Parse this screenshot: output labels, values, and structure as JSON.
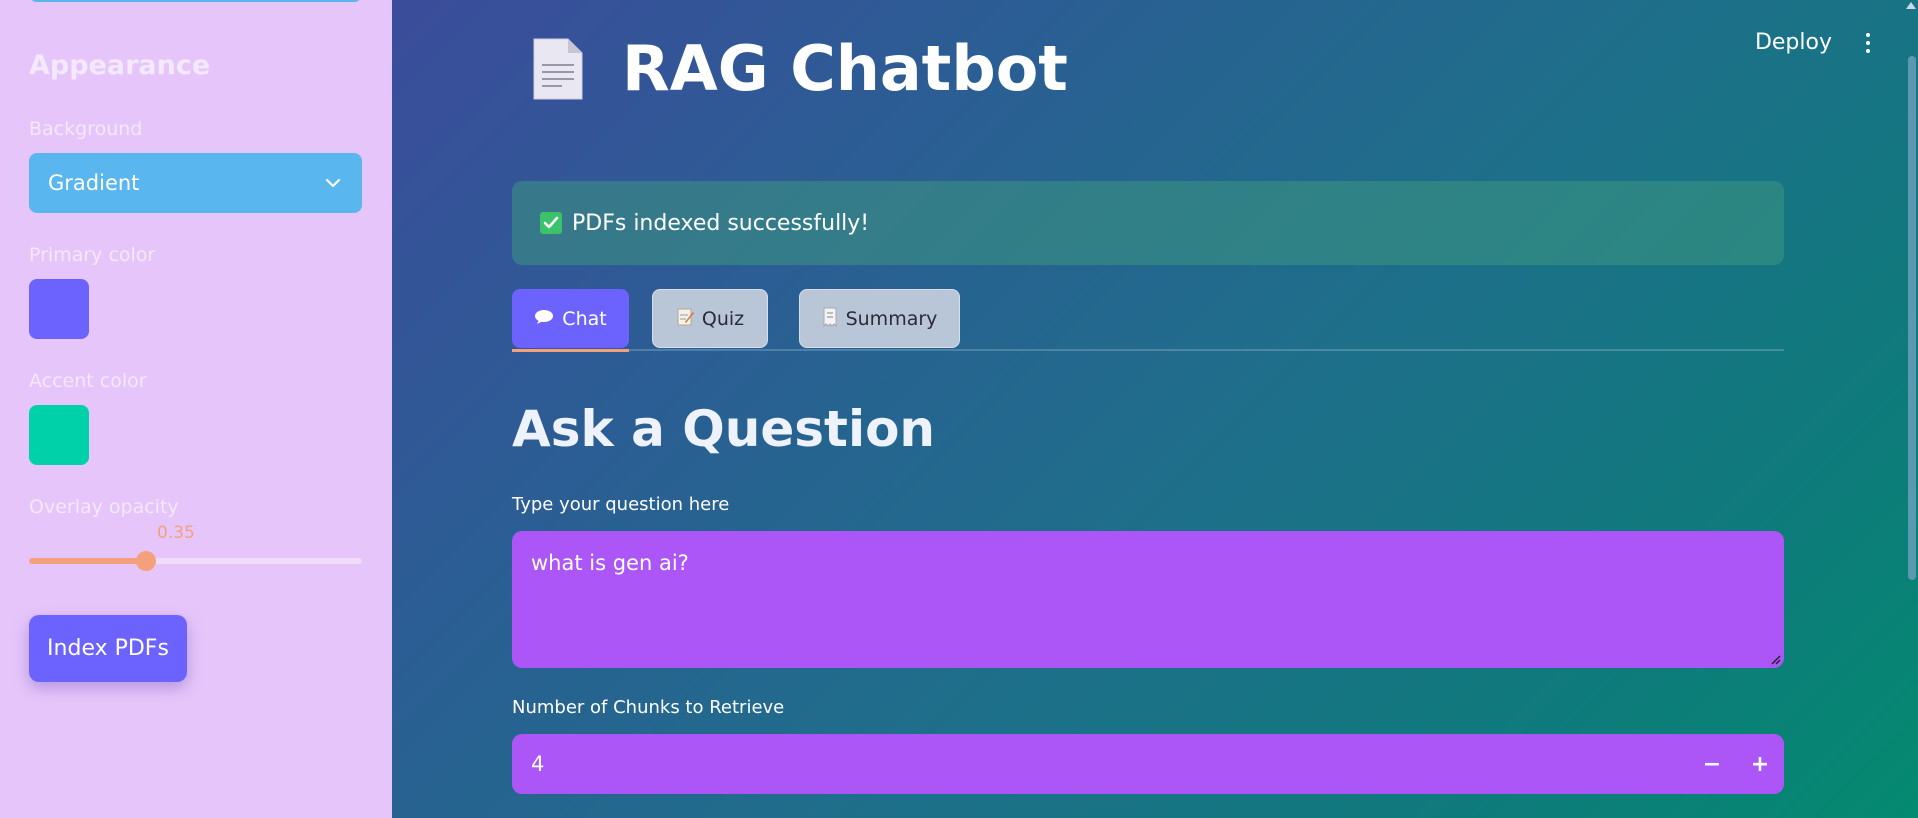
{
  "sidebar": {
    "appearance_heading": "Appearance",
    "background_label": "Background",
    "background_value": "Gradient",
    "primary_color_label": "Primary color",
    "primary_color": "#6c63ff",
    "accent_color_label": "Accent color",
    "accent_color": "#00d1a8",
    "overlay_opacity_label": "Overlay opacity",
    "overlay_opacity_value": "0.35",
    "overlay_opacity_fraction": 0.35,
    "index_button": "Index PDFs"
  },
  "header": {
    "deploy_label": "Deploy",
    "menu_icon": "kebab-menu-icon"
  },
  "main": {
    "title_icon": "document-icon",
    "title": "RAG Chatbot",
    "alert_icon": "checkmark-icon",
    "alert_text": "PDFs indexed successfully!",
    "tabs": [
      {
        "icon": "speech-bubble-icon",
        "label": "Chat"
      },
      {
        "icon": "memo-icon",
        "label": "Quiz"
      },
      {
        "icon": "receipt-icon",
        "label": "Summary"
      }
    ],
    "section_title": "Ask a Question",
    "question_label": "Type your question here",
    "question_value": "what is gen ai?",
    "chunks_label": "Number of Chunks to Retrieve",
    "chunks_value": "4",
    "minus_label": "−",
    "plus_label": "+"
  }
}
